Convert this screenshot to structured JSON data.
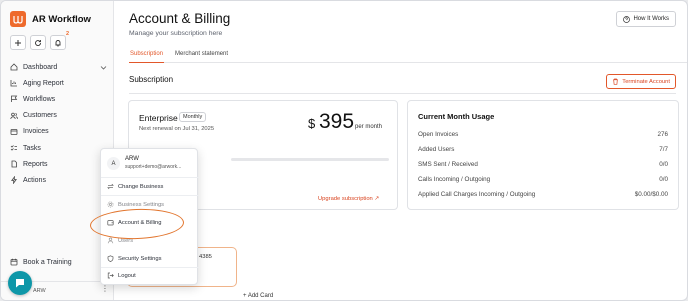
{
  "app": {
    "name": "AR Workflow",
    "brand_color": "#ee6a2c",
    "notification_count": "2"
  },
  "sidebar": {
    "top_icons": [
      "plus-icon",
      "refresh-icon",
      "bell-icon"
    ],
    "items": [
      {
        "label": "Dashboard",
        "icon": "home-icon",
        "has_chevron": true
      },
      {
        "label": "Aging Report",
        "icon": "chart-icon"
      },
      {
        "label": "Workflows",
        "icon": "flag-icon"
      },
      {
        "label": "Customers",
        "icon": "users-icon"
      },
      {
        "label": "Invoices",
        "icon": "invoice-icon"
      },
      {
        "label": "Tasks",
        "icon": "tasks-icon"
      },
      {
        "label": "Reports",
        "icon": "report-icon"
      },
      {
        "label": "Actions",
        "icon": "bolt-icon",
        "has_chevron": true
      }
    ],
    "book_training": "Book a Training",
    "profile_short": "ARW"
  },
  "header": {
    "title": "Account & Billing",
    "subtitle": "Manage your subscription here",
    "how_it_works": "How It Works"
  },
  "tabs": [
    {
      "label": "Subscription",
      "active": true
    },
    {
      "label": "Merchant statement",
      "active": false
    }
  ],
  "subscription": {
    "section_title": "Subscription",
    "terminate_label": "Terminate Account",
    "plan": {
      "name": "Enterprise",
      "cycle": "Monthly",
      "renewal": "Next renewal on Jul 31, 2025",
      "currency": "$",
      "amount": "395",
      "per": "per month",
      "upgrade_label": "Upgrade subscription"
    },
    "usage": {
      "title": "Current Month Usage",
      "rows": [
        {
          "label": "Open Invoices",
          "value": "276"
        },
        {
          "label": "Added Users",
          "value": "7/7"
        },
        {
          "label": "SMS Sent / Received",
          "value": "0/0"
        },
        {
          "label": "Calls Incoming / Outgoing",
          "value": "0/0"
        },
        {
          "label": "Applied Call Charges Incoming / Outgoing",
          "value": "$0.00/$0.00"
        }
      ]
    },
    "payment_card_fragment": "4385",
    "add_card_label": "+ Add Card"
  },
  "profile_menu": {
    "avatar_letter": "A",
    "org": "ARW",
    "email": "support+demo@arwork...",
    "items": [
      {
        "label": "Change Business",
        "icon": "swap-icon"
      },
      {
        "label": "Business Settings",
        "icon": "gear-icon"
      },
      {
        "label": "Account & Billing",
        "icon": "wallet-icon",
        "highlighted": true
      },
      {
        "label": "Users",
        "icon": "user-icon"
      },
      {
        "label": "Security Settings",
        "icon": "shield-icon"
      },
      {
        "label": "Logout",
        "icon": "logout-icon"
      }
    ]
  }
}
